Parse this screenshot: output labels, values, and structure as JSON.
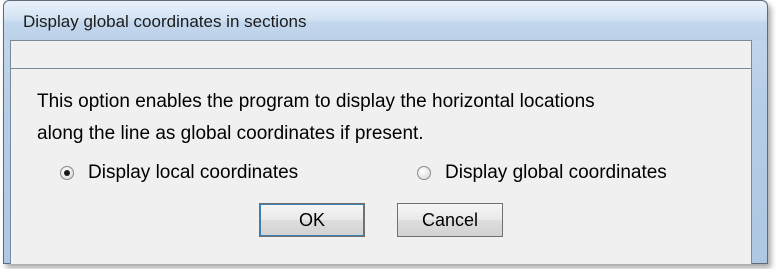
{
  "dialog": {
    "title": "Display global coordinates in sections",
    "message_line1": "This option enables the program to display the horizontal locations",
    "message_line2": "along the line as global coordinates if present.",
    "options": [
      {
        "label": "Display local coordinates",
        "checked": true
      },
      {
        "label": "Display global coordinates",
        "checked": false
      }
    ],
    "ok_label": "OK",
    "cancel_label": "Cancel"
  }
}
